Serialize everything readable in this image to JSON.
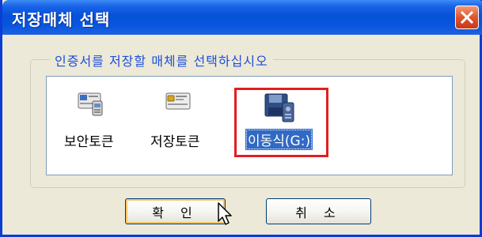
{
  "window": {
    "title": "저장매체 선택",
    "close_icon": "close-icon"
  },
  "group": {
    "legend": "인증서를 저장할 매체를 선택하십시오"
  },
  "media": [
    {
      "label": "보안토큰",
      "icon": "security-token-icon",
      "selected": false
    },
    {
      "label": "저장토큰",
      "icon": "storage-token-icon",
      "selected": false
    },
    {
      "label": "이동식(G:)",
      "icon": "removable-disk-icon",
      "selected": true
    }
  ],
  "buttons": {
    "ok": "확 인",
    "cancel": "취 소"
  },
  "colors": {
    "titlebar": "#0552D8",
    "selection": "#316AC5",
    "highlight_frame": "#E21E1E",
    "legend_text": "#1C4EDB"
  }
}
